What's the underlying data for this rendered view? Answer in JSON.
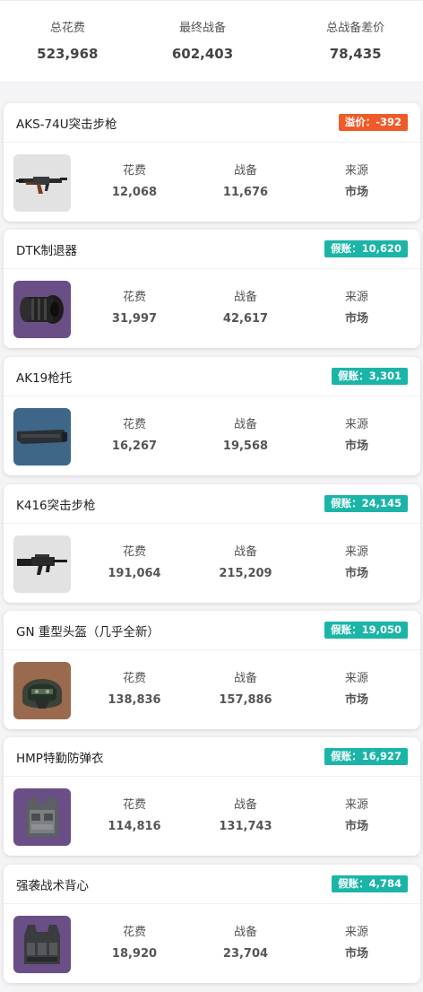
{
  "summary": {
    "total_cost": {
      "label": "总花费",
      "value": "523,968"
    },
    "final_gear": {
      "label": "最终战备",
      "value": "602,403"
    },
    "gear_diff": {
      "label": "总战备差价",
      "value": "78,435"
    }
  },
  "colors": {
    "overprice": "#f05a28",
    "fake": "#1bb5a8"
  },
  "items": [
    {
      "name": "AKS-74U突击步枪",
      "badge": "溢价：-392",
      "badge_type": "overprice",
      "icon": "rifle-aks74u-icon",
      "cost_label": "花费",
      "cost": "12,068",
      "gear_label": "战备",
      "gear": "11,676",
      "source_label": "来源",
      "source": "市场"
    },
    {
      "name": "DTK制退器",
      "badge": "假账：10,620",
      "badge_type": "fake",
      "icon": "muzzle-brake-icon",
      "cost_label": "花费",
      "cost": "31,997",
      "gear_label": "战备",
      "gear": "42,617",
      "source_label": "来源",
      "source": "市场"
    },
    {
      "name": "AK19枪托",
      "badge": "假账：3,301",
      "badge_type": "fake",
      "icon": "gun-stock-icon",
      "cost_label": "花费",
      "cost": "16,267",
      "gear_label": "战备",
      "gear": "19,568",
      "source_label": "来源",
      "source": "市场"
    },
    {
      "name": "K416突击步枪",
      "badge": "假账：24,145",
      "badge_type": "fake",
      "icon": "rifle-k416-icon",
      "cost_label": "花费",
      "cost": "191,064",
      "gear_label": "战备",
      "gear": "215,209",
      "source_label": "来源",
      "source": "市场"
    },
    {
      "name": "GN 重型头盔（几乎全新）",
      "badge": "假账：19,050",
      "badge_type": "fake",
      "icon": "helmet-icon",
      "cost_label": "花费",
      "cost": "138,836",
      "gear_label": "战备",
      "gear": "157,886",
      "source_label": "来源",
      "source": "市场"
    },
    {
      "name": "HMP特勤防弹衣",
      "badge": "假账：16,927",
      "badge_type": "fake",
      "icon": "body-armor-icon",
      "cost_label": "花费",
      "cost": "114,816",
      "gear_label": "战备",
      "gear": "131,743",
      "source_label": "来源",
      "source": "市场"
    },
    {
      "name": "强袭战术背心",
      "badge": "假账：4,784",
      "badge_type": "fake",
      "icon": "tactical-vest-icon",
      "cost_label": "花费",
      "cost": "18,920",
      "gear_label": "战备",
      "gear": "23,704",
      "source_label": "来源",
      "source": "市场"
    }
  ]
}
